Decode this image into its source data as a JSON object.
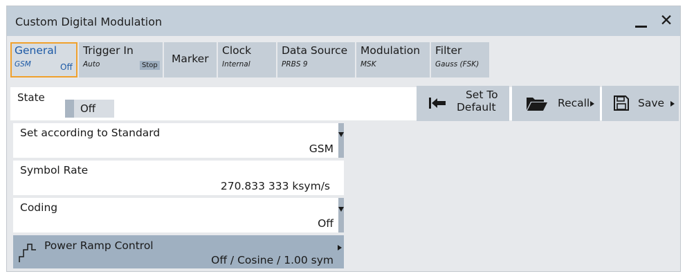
{
  "window": {
    "title": "Custom Digital Modulation",
    "minimize_icon": "minimize-icon",
    "close_icon": "close-icon",
    "close_glyph": "✕"
  },
  "tabs": [
    {
      "label": "General",
      "sub": "GSM",
      "tag": "Off"
    },
    {
      "label": "Trigger In",
      "sub": "Auto",
      "tag": "Stop"
    },
    {
      "label": "Marker"
    },
    {
      "label": "Clock",
      "sub": "Internal"
    },
    {
      "label": "Data Source",
      "sub": "PRBS 9"
    },
    {
      "label": "Modulation",
      "sub": "MSK"
    },
    {
      "label": "Filter",
      "sub": "Gauss (FSK)"
    }
  ],
  "state": {
    "label": "State",
    "value": "Off"
  },
  "buttons": {
    "set_to_default_line1": "Set To",
    "set_to_default_line2": "Default",
    "recall": "Recall",
    "save": "Save"
  },
  "fields": {
    "standard": {
      "label": "Set according to Standard",
      "value": "GSM"
    },
    "symbol_rate": {
      "label": "Symbol Rate",
      "value": "270.833 333 ksym/s"
    },
    "coding": {
      "label": "Coding",
      "value": "Off"
    },
    "power_ramp": {
      "label": "Power Ramp Control",
      "value": "Off / Cosine / 1.00 sym"
    }
  },
  "colors": {
    "titlebar": "#c3cfda",
    "tab": "#c5ced7",
    "active_tab_border": "#f0a12d",
    "active_tab_text": "#1d5aa6",
    "selected_row": "#9fb0c1"
  }
}
